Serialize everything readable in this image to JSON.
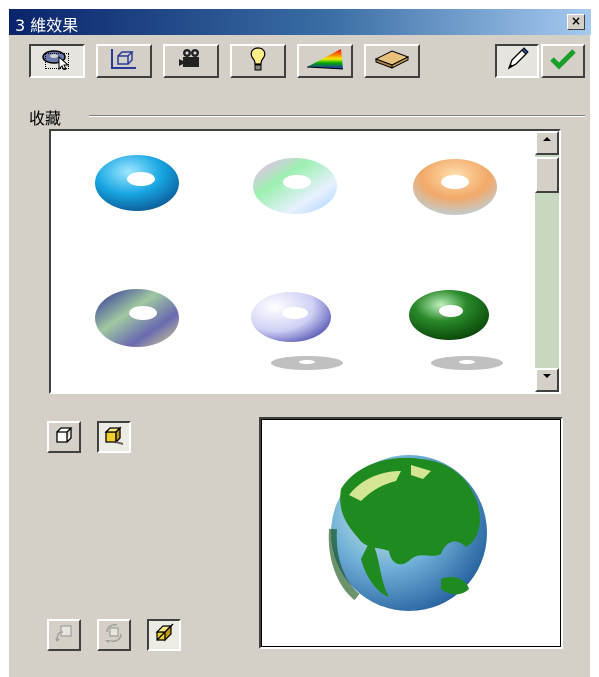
{
  "window": {
    "title": "3 維效果",
    "close_label": "×"
  },
  "toolbar": {
    "tools": [
      {
        "name": "select-tool",
        "icon": "pointer-icon",
        "pressed": true
      },
      {
        "name": "perspective-tool",
        "icon": "perspective-cube-icon",
        "pressed": false
      },
      {
        "name": "camera-tool",
        "icon": "camera-icon",
        "pressed": false
      },
      {
        "name": "lighting-tool",
        "icon": "lightbulb-icon",
        "pressed": false
      },
      {
        "name": "color-tool",
        "icon": "rainbow-icon",
        "pressed": false
      },
      {
        "name": "material-tool",
        "icon": "material-slab-icon",
        "pressed": false
      }
    ],
    "actions": [
      {
        "name": "eyedropper",
        "icon": "pen-icon",
        "pressed": true
      },
      {
        "name": "apply",
        "icon": "checkmark-icon",
        "pressed": false
      }
    ]
  },
  "gallery": {
    "label": "收藏",
    "items": [
      {
        "name": "blue-torus",
        "color": "#1aa6e6",
        "shadow": false
      },
      {
        "name": "rainbow-torus",
        "color": "#b7f0c8",
        "shadow": false
      },
      {
        "name": "orange-torus",
        "color": "#f2b27a",
        "shadow": false
      },
      {
        "name": "mixed-torus",
        "color": "#7a82c8",
        "shadow": false
      },
      {
        "name": "white-torus",
        "color": "#dcdcf6",
        "shadow": true
      },
      {
        "name": "green-torus",
        "color": "#1f7a1f",
        "shadow": true
      }
    ]
  },
  "view_buttons": [
    {
      "name": "wireframe-view",
      "icon": "wire-cube-icon",
      "pressed": false
    },
    {
      "name": "solid-view",
      "icon": "solid-cube-icon",
      "pressed": true
    }
  ],
  "bottom_buttons": [
    {
      "name": "rotate-left",
      "icon": "rotate-left-icon",
      "disabled": true
    },
    {
      "name": "rotate-free",
      "icon": "rotate-free-icon",
      "disabled": true
    },
    {
      "name": "extrude",
      "icon": "extrude-icon",
      "disabled": false,
      "pressed": true
    }
  ],
  "preview": {
    "object": "globe",
    "ocean_color": "#3d7fbf",
    "land_color": "#1f8a1f"
  }
}
